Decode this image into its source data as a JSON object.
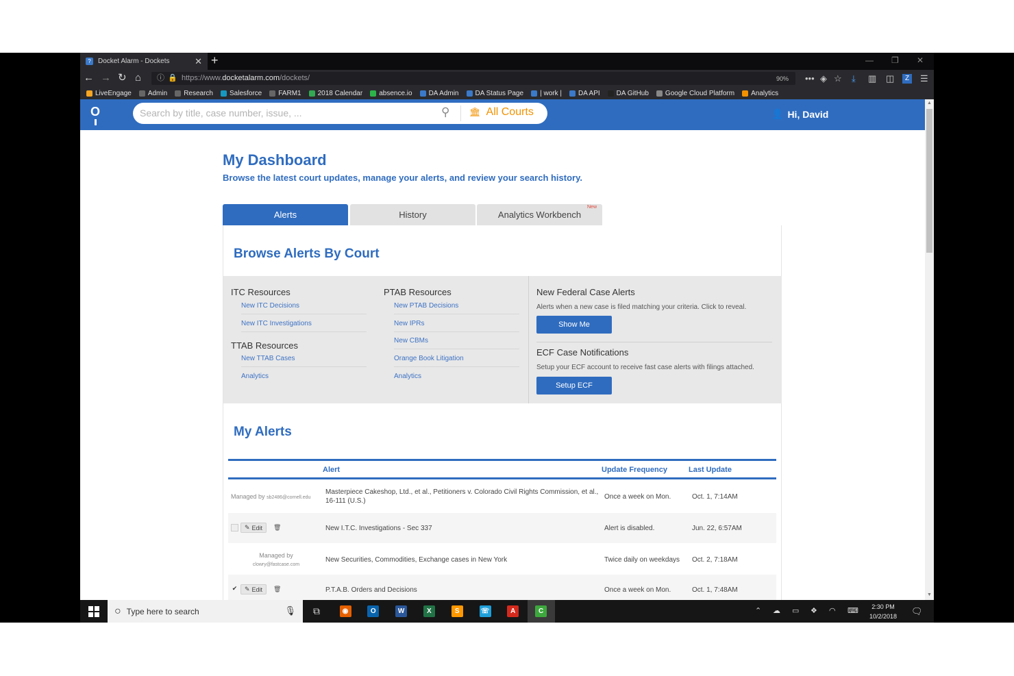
{
  "browser": {
    "tab_title": "Docket Alarm - Dockets",
    "url_prefix": "https://www.",
    "url_domain": "docketalarm.com",
    "url_path": "/dockets/",
    "zoom": "90%",
    "bookmarks": [
      {
        "label": "LiveEngage",
        "color": "#f5a623"
      },
      {
        "label": "Admin",
        "color": "#666666"
      },
      {
        "label": "Research",
        "color": "#666666"
      },
      {
        "label": "Salesforce",
        "color": "#1798c1"
      },
      {
        "label": "FARM1",
        "color": "#666666"
      },
      {
        "label": "2018 Calendar",
        "color": "#34a853"
      },
      {
        "label": "absence.io",
        "color": "#2db34a"
      },
      {
        "label": "DA Admin",
        "color": "#3b79c9"
      },
      {
        "label": "DA Status Page",
        "color": "#3b79c9"
      },
      {
        "label": "| work |",
        "color": "#3b79c9"
      },
      {
        "label": "DA API",
        "color": "#3b79c9"
      },
      {
        "label": "DA GitHub",
        "color": "#222222"
      },
      {
        "label": "Google Cloud Platform",
        "color": "#888888"
      },
      {
        "label": "Analytics",
        "color": "#f29200"
      }
    ]
  },
  "header": {
    "search_placeholder": "Search by title, case number, issue, ...",
    "courts_label": "All Courts",
    "user_greeting": "Hi, David"
  },
  "page": {
    "title": "My Dashboard",
    "subtitle": "Browse the latest court updates, manage your alerts, and review your search history."
  },
  "tabs": {
    "alerts": "Alerts",
    "history": "History",
    "analytics": "Analytics Workbench",
    "new_badge": "New"
  },
  "browse": {
    "title": "Browse Alerts By Court",
    "itc_heading": "ITC Resources",
    "itc_links": [
      "New ITC Decisions",
      "New ITC Investigations"
    ],
    "ttab_heading": "TTAB Resources",
    "ttab_links": [
      "New TTAB Cases",
      "Analytics"
    ],
    "ptab_heading": "PTAB Resources",
    "ptab_links": [
      "New PTAB Decisions",
      "New IPRs",
      "New CBMs",
      "Orange Book Litigation",
      "Analytics"
    ],
    "federal": {
      "title": "New Federal Case Alerts",
      "desc": "Alerts when a new case is filed matching your criteria. Click to reveal.",
      "button": "Show Me"
    },
    "ecf": {
      "title": "ECF Case Notifications",
      "desc": "Setup your ECF account to receive fast case alerts with filings attached.",
      "button": "Setup ECF"
    }
  },
  "my_alerts": {
    "title": "My Alerts",
    "headers": {
      "alert": "Alert",
      "frequency": "Update Frequency",
      "last_update": "Last Update"
    },
    "edit_label": "Edit",
    "managed_by_label": "Managed by",
    "rows": [
      {
        "manager": "sb2486@cornell.edu",
        "alert": "Masterpiece Cakeshop, Ltd., et al., Petitioners v. Colorado Civil Rights Commission, et al., 16-111 (U.S.)",
        "frequency": "Once a week on Mon.",
        "last_update": "Oct. 1, 7:14AM"
      },
      {
        "alert": "New I.T.C. Investigations - Sec 337",
        "frequency": "Alert is disabled.",
        "last_update": "Jun. 22, 6:57AM"
      },
      {
        "manager": "clowry@fastcase.com",
        "alert": "New Securities, Commodities, Exchange cases in New York",
        "frequency": "Twice daily on weekdays",
        "last_update": "Oct. 2, 7:18AM"
      },
      {
        "alert": "P.T.A.B. Orders and Decisions",
        "frequency": "Once a week on Mon.",
        "last_update": "Oct. 1, 7:48AM"
      }
    ]
  },
  "taskbar": {
    "search_placeholder": "Type here to search",
    "time": "2:30 PM",
    "date": "10/2/2018",
    "apps": [
      {
        "icon": "firefox-icon",
        "color": "#e66000"
      },
      {
        "icon": "outlook-icon",
        "color": "#0a64ad"
      },
      {
        "icon": "word-icon",
        "color": "#2b579a"
      },
      {
        "icon": "excel-icon",
        "color": "#217346"
      },
      {
        "icon": "sublime-icon",
        "color": "#ff9800"
      },
      {
        "icon": "phone-icon",
        "color": "#1f9fd8"
      },
      {
        "icon": "acrobat-icon",
        "color": "#d42a1e"
      },
      {
        "icon": "camtasia-icon",
        "color": "#3da83d"
      }
    ]
  }
}
